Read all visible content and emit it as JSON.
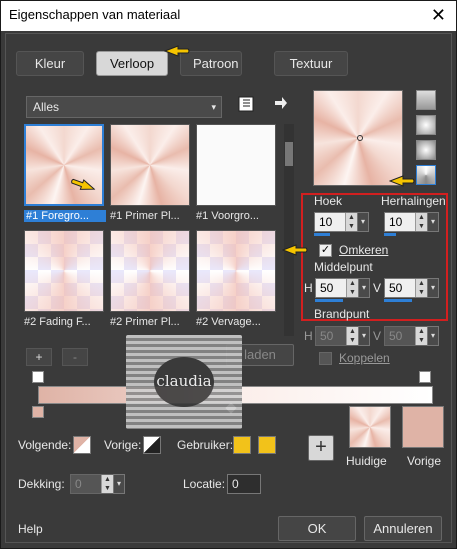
{
  "window": {
    "title": "Eigenschappen van materiaal",
    "close": "✕"
  },
  "tabs": [
    {
      "label": "Kleur"
    },
    {
      "label": "Verloop"
    },
    {
      "label": "Patroon"
    },
    {
      "label": "Textuur"
    }
  ],
  "filter": {
    "value": "Alles",
    "arrow": "▾"
  },
  "thumbnails": [
    {
      "label": "#1 Foregro..."
    },
    {
      "label": "#1 Primer Pl..."
    },
    {
      "label": "#1 Voorgro..."
    },
    {
      "label": "#2 Fading F..."
    },
    {
      "label": "#2 Primer Pl..."
    },
    {
      "label": "#2 Vervage..."
    }
  ],
  "settings": {
    "hoek_label": "Hoek",
    "hoek_value": "10",
    "herhalingen_label": "Herhalingen",
    "herhalingen_value": "10",
    "omkeren_label": "Omkeren",
    "omkeren_checked": "✓",
    "middelpunt_label": "Middelpunt",
    "h_label": "H",
    "h_value": "50",
    "v_label": "V",
    "v_value": "50",
    "brandpunt_label": "Brandpunt",
    "bh_label": "H",
    "bh_value": "50",
    "bv_label": "V",
    "bv_value": "50",
    "koppelen_label": "Koppelen"
  },
  "buttons": {
    "add": "+",
    "remove": "-",
    "laden": "laden",
    "ok": "OK",
    "annuleren": "Annuleren",
    "help": "Help",
    "plus": "+"
  },
  "watermark": {
    "text": "claudia"
  },
  "bottom": {
    "volgende_label": "Volgende:",
    "vorige_label": "Vorige:",
    "gebruiker_label": "Gebruiker:",
    "dekking_label": "Dekking:",
    "dekking_value": "0",
    "locatie_label": "Locatie:",
    "locatie_value": "0",
    "huidige_label": "Huidige",
    "vorige2_label": "Vorige"
  },
  "colors": {
    "accent": "#2e7fd6",
    "highlight": "#d21f1f",
    "user_swatch": "#f2c21a",
    "vorige_swatch": "#dfb3a6"
  }
}
